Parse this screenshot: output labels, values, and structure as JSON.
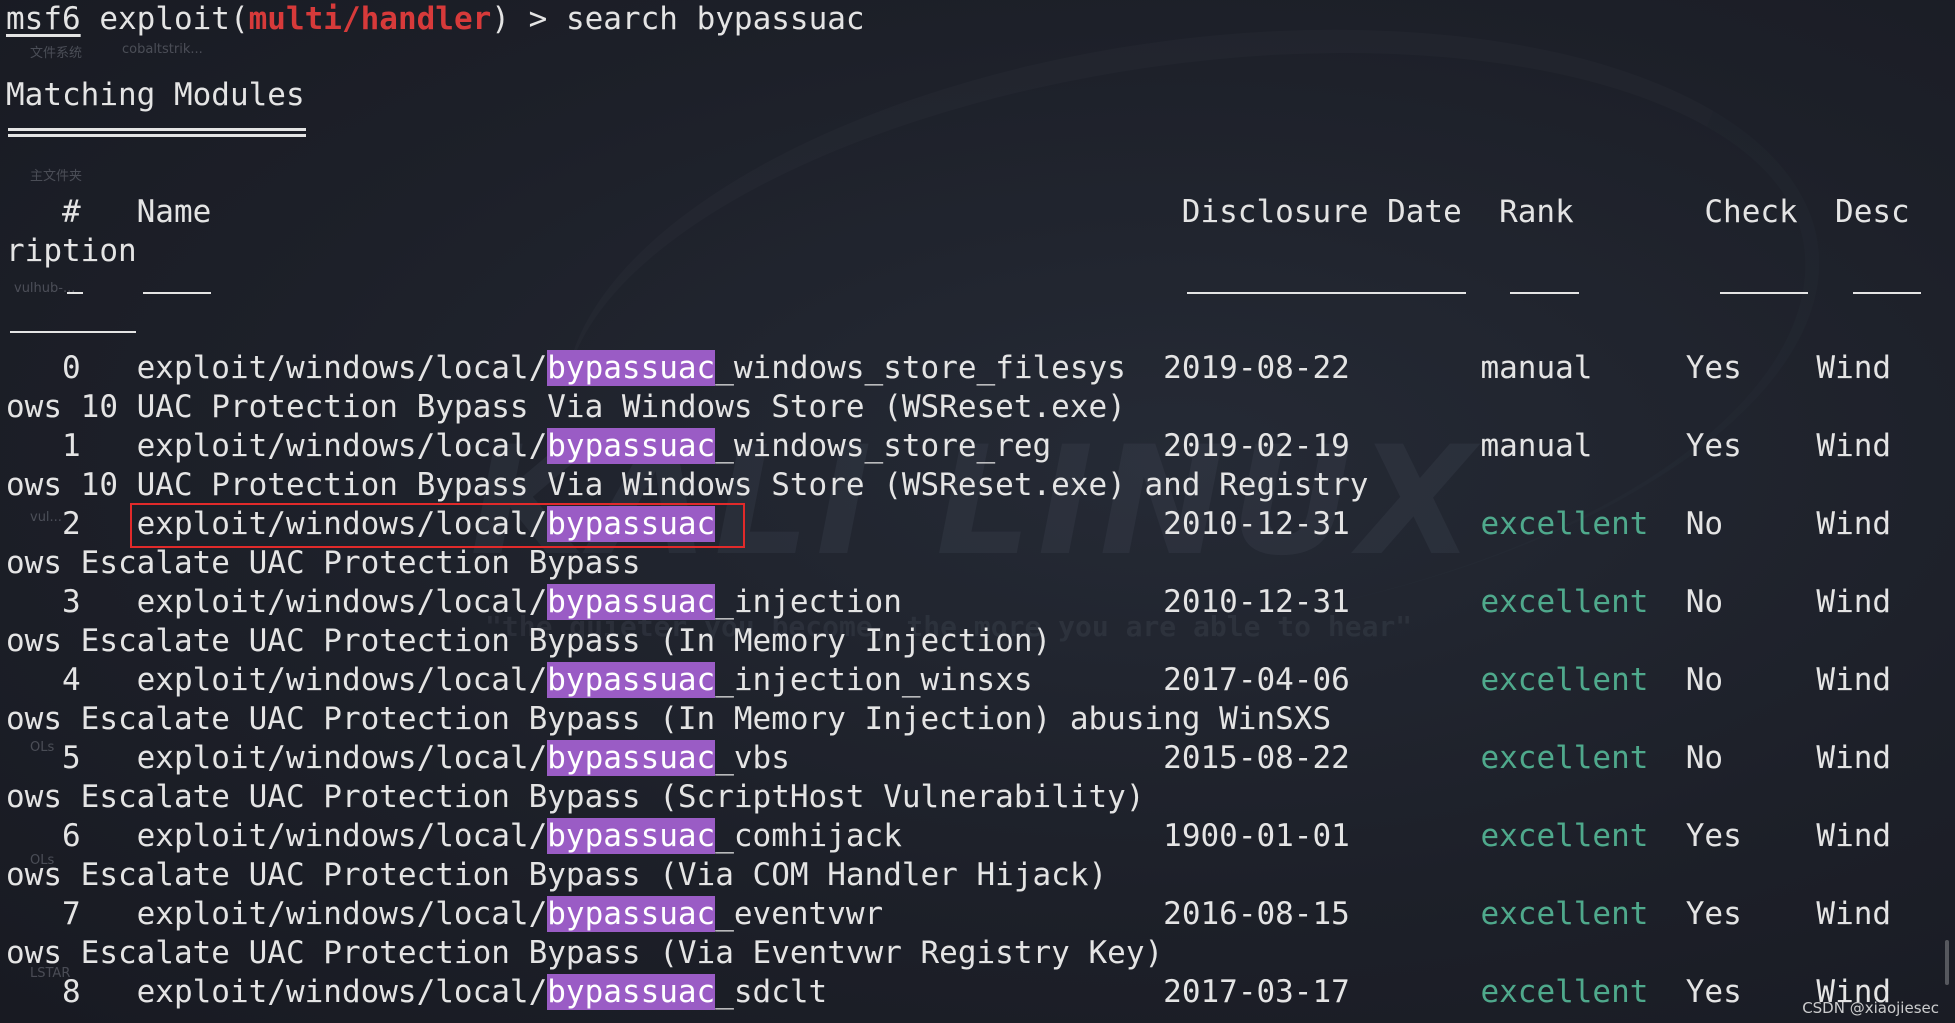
{
  "prompt": {
    "prefix": "msf6",
    "space": " ",
    "exploit_open": "exploit(",
    "module": "multi/handler",
    "close": ") > ",
    "command": "search bypassuac"
  },
  "section_title": "Matching Modules",
  "header": {
    "line1": "   #   Name                                                    Disclosure Date  Rank       Check  Desc",
    "line2": "ription"
  },
  "rows": [
    {
      "line": "   0   exploit/windows/local/",
      "hl": "bypassuac",
      "suffix": "_windows_store_filesys  2019-08-22       ",
      "rank": "manual   ",
      "rank_style": "plain",
      "tail": "  Yes    Wind",
      "desc": "ows 10 UAC Protection Bypass Via Windows Store (WSReset.exe)"
    },
    {
      "line": "   1   exploit/windows/local/",
      "hl": "bypassuac",
      "suffix": "_windows_store_reg      2019-02-19       ",
      "rank": "manual   ",
      "rank_style": "plain",
      "tail": "  Yes    Wind",
      "desc": "ows 10 UAC Protection Bypass Via Windows Store (WSReset.exe) and Registry"
    },
    {
      "line": "   2   exploit/windows/local/",
      "hl": "bypassuac",
      "suffix": "                        2010-12-31       ",
      "rank": "excellent",
      "rank_style": "green",
      "tail": "  No     Wind",
      "desc": "ows Escalate UAC Protection Bypass"
    },
    {
      "line": "   3   exploit/windows/local/",
      "hl": "bypassuac",
      "suffix": "_injection              2010-12-31       ",
      "rank": "excellent",
      "rank_style": "green",
      "tail": "  No     Wind",
      "desc": "ows Escalate UAC Protection Bypass (In Memory Injection)"
    },
    {
      "line": "   4   exploit/windows/local/",
      "hl": "bypassuac",
      "suffix": "_injection_winsxs       2017-04-06       ",
      "rank": "excellent",
      "rank_style": "green",
      "tail": "  No     Wind",
      "desc": "ows Escalate UAC Protection Bypass (In Memory Injection) abusing WinSXS"
    },
    {
      "line": "   5   exploit/windows/local/",
      "hl": "bypassuac",
      "suffix": "_vbs                    2015-08-22       ",
      "rank": "excellent",
      "rank_style": "green",
      "tail": "  No     Wind",
      "desc": "ows Escalate UAC Protection Bypass (ScriptHost Vulnerability)"
    },
    {
      "line": "   6   exploit/windows/local/",
      "hl": "bypassuac",
      "suffix": "_comhijack              1900-01-01       ",
      "rank": "excellent",
      "rank_style": "green",
      "tail": "  Yes    Wind",
      "desc": "ows Escalate UAC Protection Bypass (Via COM Handler Hijack)"
    },
    {
      "line": "   7   exploit/windows/local/",
      "hl": "bypassuac",
      "suffix": "_eventvwr               2016-08-15       ",
      "rank": "excellent",
      "rank_style": "green",
      "tail": "  Yes    Wind",
      "desc": "ows Escalate UAC Protection Bypass (Via Eventvwr Registry Key)"
    },
    {
      "line": "   8   exploit/windows/local/",
      "hl": "bypassuac",
      "suffix": "_sdclt                  2017-03-17       ",
      "rank": "excellent",
      "rank_style": "green",
      "tail": "  Yes    Wind",
      "desc": ""
    }
  ],
  "background": {
    "logo": "KALI LINUX",
    "tagline": "\"the quieter you become, the more you are able to hear\"",
    "desktop_labels": [
      "文件系统",
      "cobaltstrik...",
      "主文件夹",
      "vulhub-...",
      "vul...",
      "OLs",
      "OLs",
      "LSTAR"
    ]
  },
  "colors": {
    "background": "#1d2029",
    "text": "#e4e4e4",
    "prompt_red": "#d73a3a",
    "highlight": "#9a5cc5",
    "rank_green": "#4fa98c",
    "annotation_box": "#e12a2a"
  },
  "watermark": "CSDN @xiaojiesec"
}
